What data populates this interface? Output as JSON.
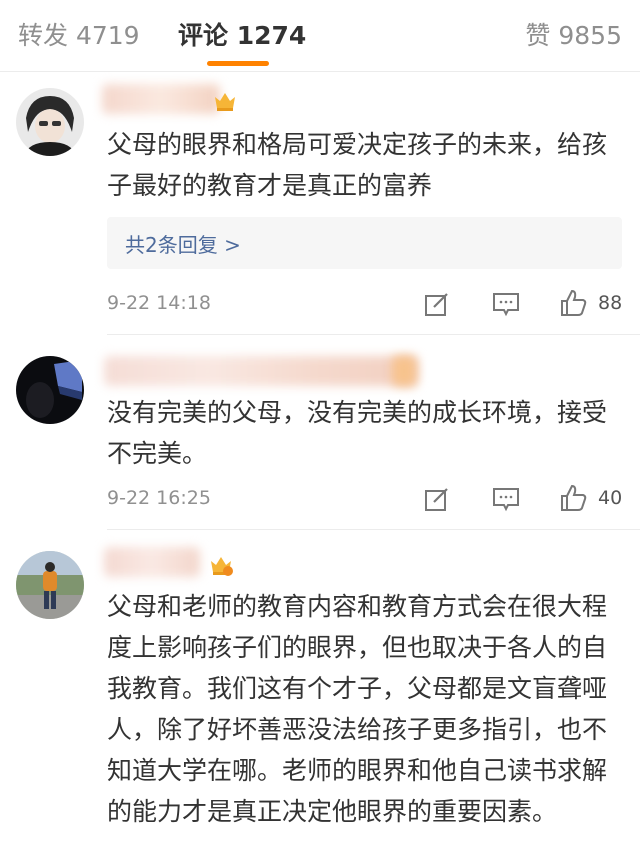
{
  "tabs": {
    "repost": "转发 4719",
    "comments": "评论 1274",
    "likes": "赞 9855"
  },
  "colors": {
    "accent": "#ff8200",
    "link": "#4e6b9c"
  },
  "comments": [
    {
      "text": "父母的眼界和格局可爱决定孩子的未来，给孩子最好的教育才是真正的富养",
      "reply_link": "共2条回复 >",
      "time": "9-22 14:18",
      "likes": "88"
    },
    {
      "text": "没有完美的父母，没有完美的成长环境，接受不完美。",
      "time": "9-22 16:25",
      "likes": "40"
    },
    {
      "text": "父母和老师的教育内容和教育方式会在很大程度上影响孩子们的眼界，但也取决于各人的自我教育。我们这有个才子，父母都是文盲聋哑人，除了好坏善恶没法给孩子更多指引，也不知道大学在哪。老师的眼界和他自己读书求解的能力才是真正决定他眼界的重要因素。"
    }
  ],
  "icons": [
    "edit-icon",
    "comment-icon",
    "thumbs-up-icon",
    "vip-crown-icon"
  ]
}
